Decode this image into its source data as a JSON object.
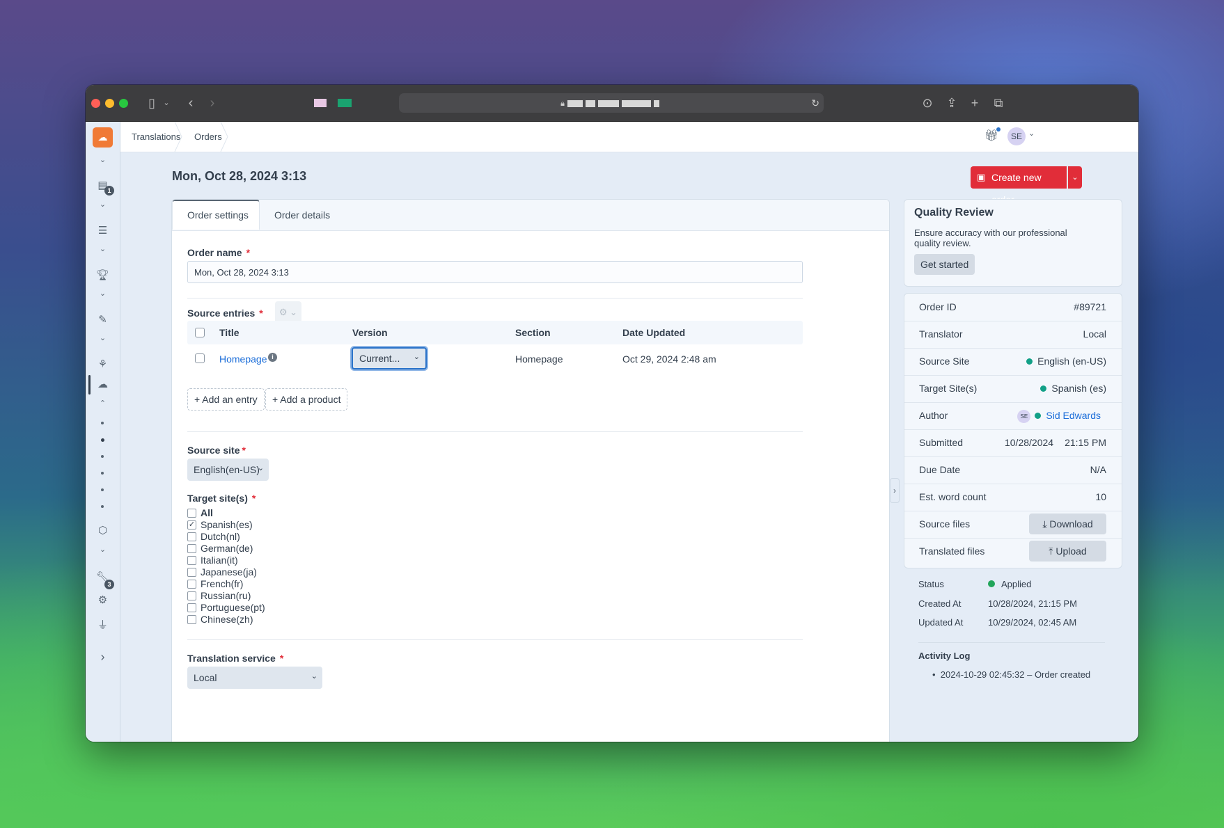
{
  "browser": {
    "tab_icons": [
      "pinned-tab-pink",
      "pinned-tab-green"
    ],
    "url_obscured": true
  },
  "breadcrumb": {
    "items": [
      "Translations",
      "Orders"
    ]
  },
  "header": {
    "user_initials": "SE"
  },
  "nav": {
    "badges": {
      "translations": "1",
      "utilities": "3"
    }
  },
  "page": {
    "title": "Mon, Oct 28, 2024 3:13",
    "create_button": "Create new order"
  },
  "tabs": [
    "Order settings",
    "Order details"
  ],
  "form": {
    "order_name_label": "Order name",
    "order_name_value": "Mon, Oct 28, 2024 3:13",
    "source_entries_label": "Source entries",
    "table_headers": [
      "Title",
      "Version",
      "Section",
      "Date Updated"
    ],
    "entries": [
      {
        "title": "Homepage",
        "version": "Current...",
        "section": "Homepage",
        "date_updated": "Oct 29, 2024 2:48 am"
      }
    ],
    "add_entry": "Add an entry",
    "add_product": "Add a product",
    "source_site_label": "Source site",
    "source_site_value": "English(en-US)",
    "target_sites_label": "Target site(s)",
    "target_sites": [
      {
        "label": "All",
        "checked": false
      },
      {
        "label": "Spanish(es)",
        "checked": true
      },
      {
        "label": "Dutch(nl)",
        "checked": false
      },
      {
        "label": "German(de)",
        "checked": false
      },
      {
        "label": "Italian(it)",
        "checked": false
      },
      {
        "label": "Japanese(ja)",
        "checked": false
      },
      {
        "label": "French(fr)",
        "checked": false
      },
      {
        "label": "Russian(ru)",
        "checked": false
      },
      {
        "label": "Portuguese(pt)",
        "checked": false
      },
      {
        "label": "Chinese(zh)",
        "checked": false
      }
    ],
    "translation_service_label": "Translation service",
    "translation_service_value": "Local"
  },
  "quality_review": {
    "title": "Quality Review",
    "text": "Ensure accuracy with our professional quality review.",
    "button": "Get started"
  },
  "meta": {
    "order_id": {
      "label": "Order ID",
      "value": "#89721"
    },
    "translator": {
      "label": "Translator",
      "value": "Local"
    },
    "source_site": {
      "label": "Source Site",
      "value": "English (en-US)"
    },
    "target_sites": {
      "label": "Target Site(s)",
      "value": "Spanish (es)"
    },
    "author": {
      "label": "Author",
      "initials": "SE",
      "value": "Sid Edwards"
    },
    "submitted": {
      "label": "Submitted",
      "date": "10/28/2024",
      "time": "21:15 PM"
    },
    "due_date": {
      "label": "Due Date",
      "value": "N/A"
    },
    "word_count": {
      "label": "Est. word count",
      "value": "10"
    },
    "source_files": {
      "label": "Source files",
      "button": "Download"
    },
    "translated_files": {
      "label": "Translated files",
      "button": "Upload"
    }
  },
  "status": {
    "status_label": "Status",
    "status_value": "Applied",
    "created_label": "Created At",
    "created_value": "10/28/2024, 21:15 PM",
    "updated_label": "Updated At",
    "updated_value": "10/29/2024, 02:45 AM",
    "activity_title": "Activity Log",
    "activity_items": [
      "2024-10-29 02:45:32 – Order created"
    ]
  },
  "colors": {
    "accent": "#e12d39",
    "link": "#1c6ed9",
    "status_ok": "#12a087"
  }
}
